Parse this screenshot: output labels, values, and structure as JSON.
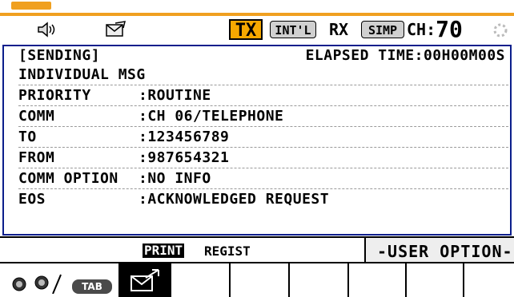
{
  "status": {
    "tx": "TX",
    "intl": "INT'L",
    "rx": "RX",
    "simp": "SIMP",
    "ch_label": "CH:",
    "ch_num": "70"
  },
  "message": {
    "sending": "[SENDING]",
    "elapsed": "ELAPSED TIME:00H00M00S",
    "title": "INDIVIDUAL MSG",
    "fields": [
      {
        "label": "PRIORITY",
        "value": ":ROUTINE"
      },
      {
        "label": "COMM",
        "value": ":CH 06/TELEPHONE"
      },
      {
        "label": "TO",
        "value": ":123456789"
      },
      {
        "label": "FROM",
        "value": ":987654321"
      },
      {
        "label": "COMM OPTION",
        "value": ":NO INFO"
      },
      {
        "label": "EOS",
        "value": ":ACKNOWLEDGED REQUEST"
      }
    ]
  },
  "softkeys": {
    "print": "PRINT",
    "regist": "REGIST",
    "user_option": "-USER OPTION-"
  },
  "fkeys": {
    "tab": "TAB"
  },
  "colors": {
    "accent": "#f6a800",
    "panel_border": "#0b1e8c"
  }
}
